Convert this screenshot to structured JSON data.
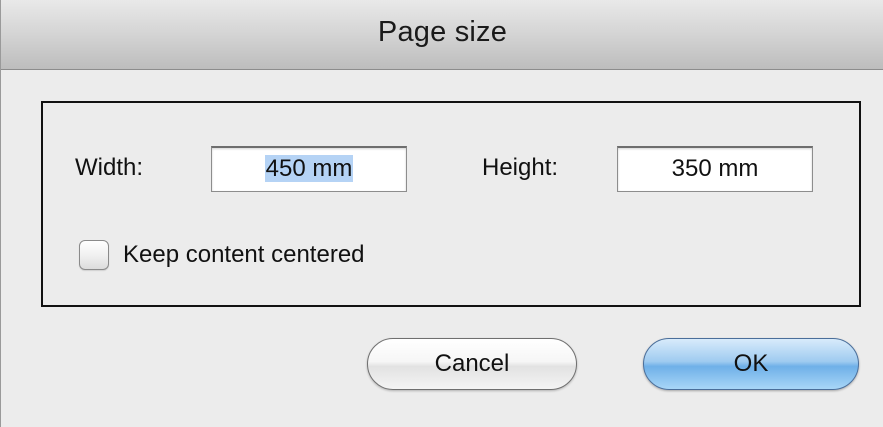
{
  "dialog": {
    "title": "Page size"
  },
  "fields": {
    "width_label": "Width:",
    "width_value": "450 mm",
    "height_label": "Height:",
    "height_value": "350 mm"
  },
  "options": {
    "keep_centered_label": "Keep content centered",
    "keep_centered_checked": false
  },
  "buttons": {
    "cancel_label": "Cancel",
    "ok_label": "OK"
  },
  "colors": {
    "selection_highlight": "#b5d3f5",
    "default_button": "#6fb0e8"
  }
}
